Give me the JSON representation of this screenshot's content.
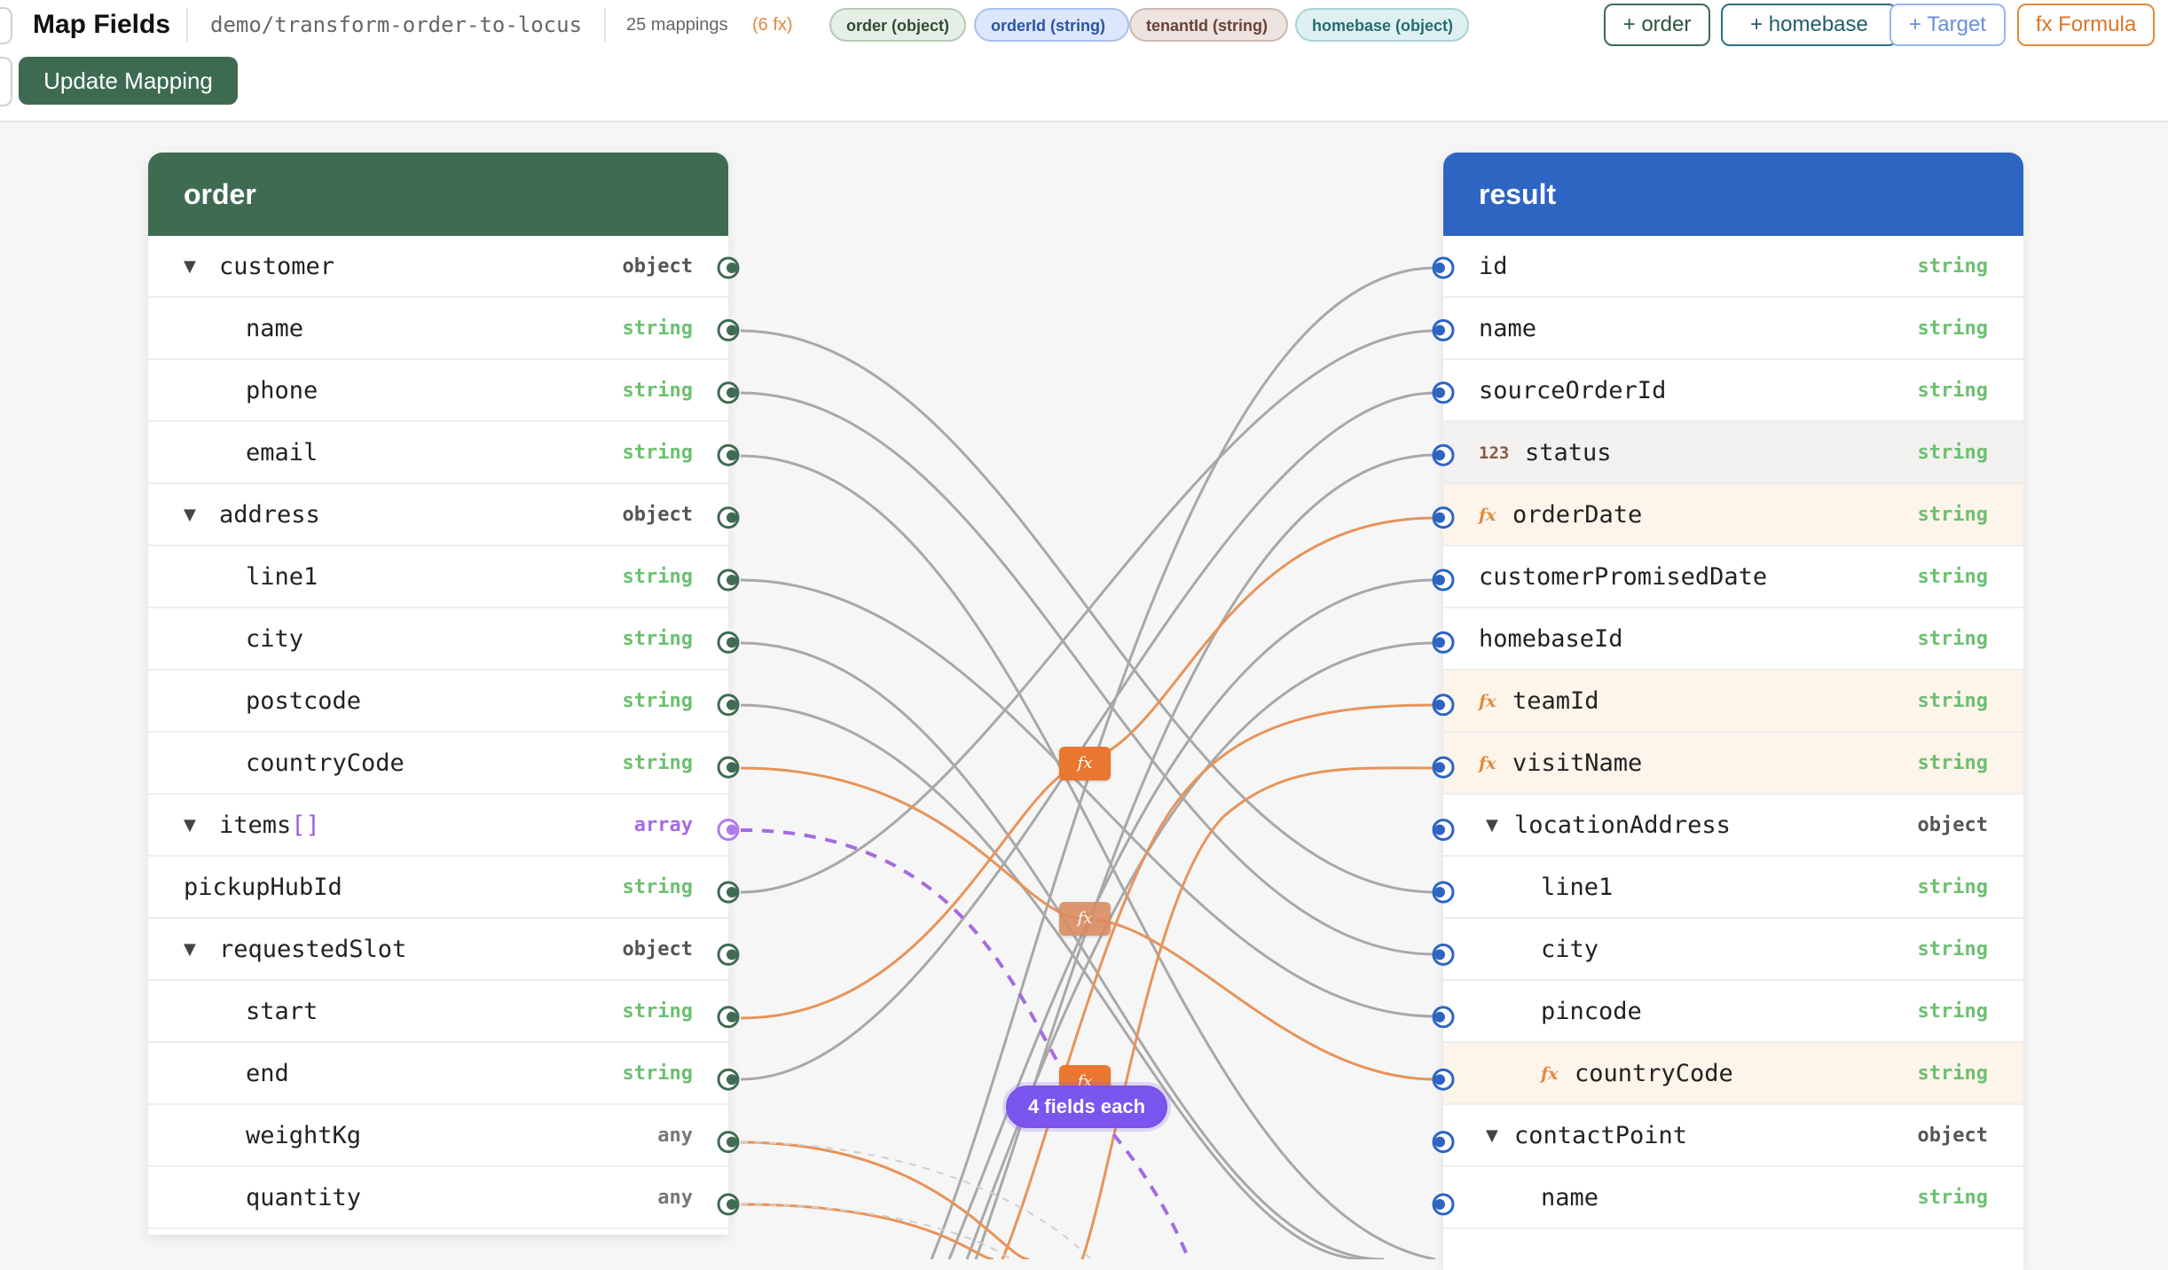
{
  "header": {
    "title": "Map Fields",
    "path": "demo/transform-order-to-locus",
    "mapping_count": "25 mappings",
    "fx_count": "(6 fx)",
    "chips": [
      "order (object)",
      "orderId (string)",
      "tenantId (string)",
      "homebase (object)"
    ],
    "buttons": {
      "add_order": "+ order",
      "add_homebase": "+ homebase",
      "add_target": "+ Target",
      "add_formula": "fx Formula"
    },
    "update_button": "Update Mapping"
  },
  "source": {
    "title": "order",
    "fields": [
      {
        "name": "customer",
        "type": "object",
        "expandable": true
      },
      {
        "name": "name",
        "type": "string",
        "indent": 1
      },
      {
        "name": "phone",
        "type": "string",
        "indent": 1
      },
      {
        "name": "email",
        "type": "string",
        "indent": 1
      },
      {
        "name": "address",
        "type": "object",
        "expandable": true
      },
      {
        "name": "line1",
        "type": "string",
        "indent": 1
      },
      {
        "name": "city",
        "type": "string",
        "indent": 1
      },
      {
        "name": "postcode",
        "type": "string",
        "indent": 1
      },
      {
        "name": "countryCode",
        "type": "string",
        "indent": 1
      },
      {
        "name": "items",
        "suffix": "[]",
        "type": "array",
        "expandable": true
      },
      {
        "name": "pickupHubId",
        "type": "string"
      },
      {
        "name": "requestedSlot",
        "type": "object",
        "expandable": true
      },
      {
        "name": "start",
        "type": "string",
        "indent": 1
      },
      {
        "name": "end",
        "type": "string",
        "indent": 1
      },
      {
        "name": "weightKg",
        "type": "any",
        "indent": 1
      },
      {
        "name": "quantity",
        "type": "any",
        "indent": 1
      }
    ]
  },
  "target": {
    "title": "result",
    "fields": [
      {
        "name": "id",
        "type": "string"
      },
      {
        "name": "name",
        "type": "string"
      },
      {
        "name": "sourceOrderId",
        "type": "string"
      },
      {
        "name": "status",
        "type": "string",
        "badge": "123"
      },
      {
        "name": "orderDate",
        "type": "string",
        "badge": "fx"
      },
      {
        "name": "customerPromisedDate",
        "type": "string"
      },
      {
        "name": "homebaseId",
        "type": "string"
      },
      {
        "name": "teamId",
        "type": "string",
        "badge": "fx"
      },
      {
        "name": "visitName",
        "type": "string",
        "badge": "fx"
      },
      {
        "name": "locationAddress",
        "type": "object",
        "expandable": true
      },
      {
        "name": "line1",
        "type": "string",
        "indent": 1
      },
      {
        "name": "city",
        "type": "string",
        "indent": 1
      },
      {
        "name": "pincode",
        "type": "string",
        "indent": 1
      },
      {
        "name": "countryCode",
        "type": "string",
        "indent": 1,
        "badge": "fx"
      },
      {
        "name": "contactPoint",
        "type": "object",
        "expandable": true
      },
      {
        "name": "name",
        "type": "string",
        "indent": 1
      }
    ]
  },
  "canvas": {
    "fx_label": "fx",
    "array_hint": "4 fields each"
  },
  "colors": {
    "source_header": "#406b53",
    "target_header": "#2e64c2",
    "mapping_line": "#a3a3a3",
    "formula_line": "#e8935a",
    "array_line": "#a46be0"
  }
}
